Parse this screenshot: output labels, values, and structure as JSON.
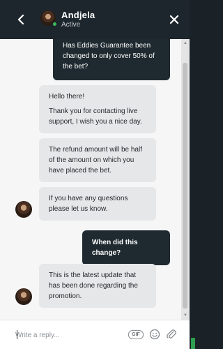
{
  "header": {
    "agent_name": "Andjela",
    "status": "Active"
  },
  "messages": [
    {
      "sender": "user",
      "lines": [
        "Has Eddies Guarantee been changed to only cover 50% of the bet?"
      ]
    },
    {
      "sender": "agent",
      "lines": [
        "Hello there!",
        "Thank you for contacting live support, I wish you a nice day."
      ]
    },
    {
      "sender": "agent",
      "lines": [
        "The refund amount will be half of the amount on which you have placed the bet."
      ]
    },
    {
      "sender": "agent",
      "lines": [
        "If you have any questions please let us know."
      ]
    },
    {
      "sender": "user",
      "lines": [
        "When did this change?"
      ]
    },
    {
      "sender": "agent",
      "lines": [
        "This is the latest update that has been done regarding the promotion."
      ]
    }
  ],
  "composer": {
    "placeholder": "Write a reply...",
    "gif_label": "GIF"
  },
  "icons": {
    "back": "chevron-left-icon",
    "close": "close-icon",
    "emoji": "smiley-icon",
    "attach": "paperclip-icon"
  },
  "colors": {
    "header_bg": "#1d262c",
    "user_bubble": "#1f2a30",
    "agent_bubble": "#e6e7e8",
    "online": "#3dbb5c"
  }
}
